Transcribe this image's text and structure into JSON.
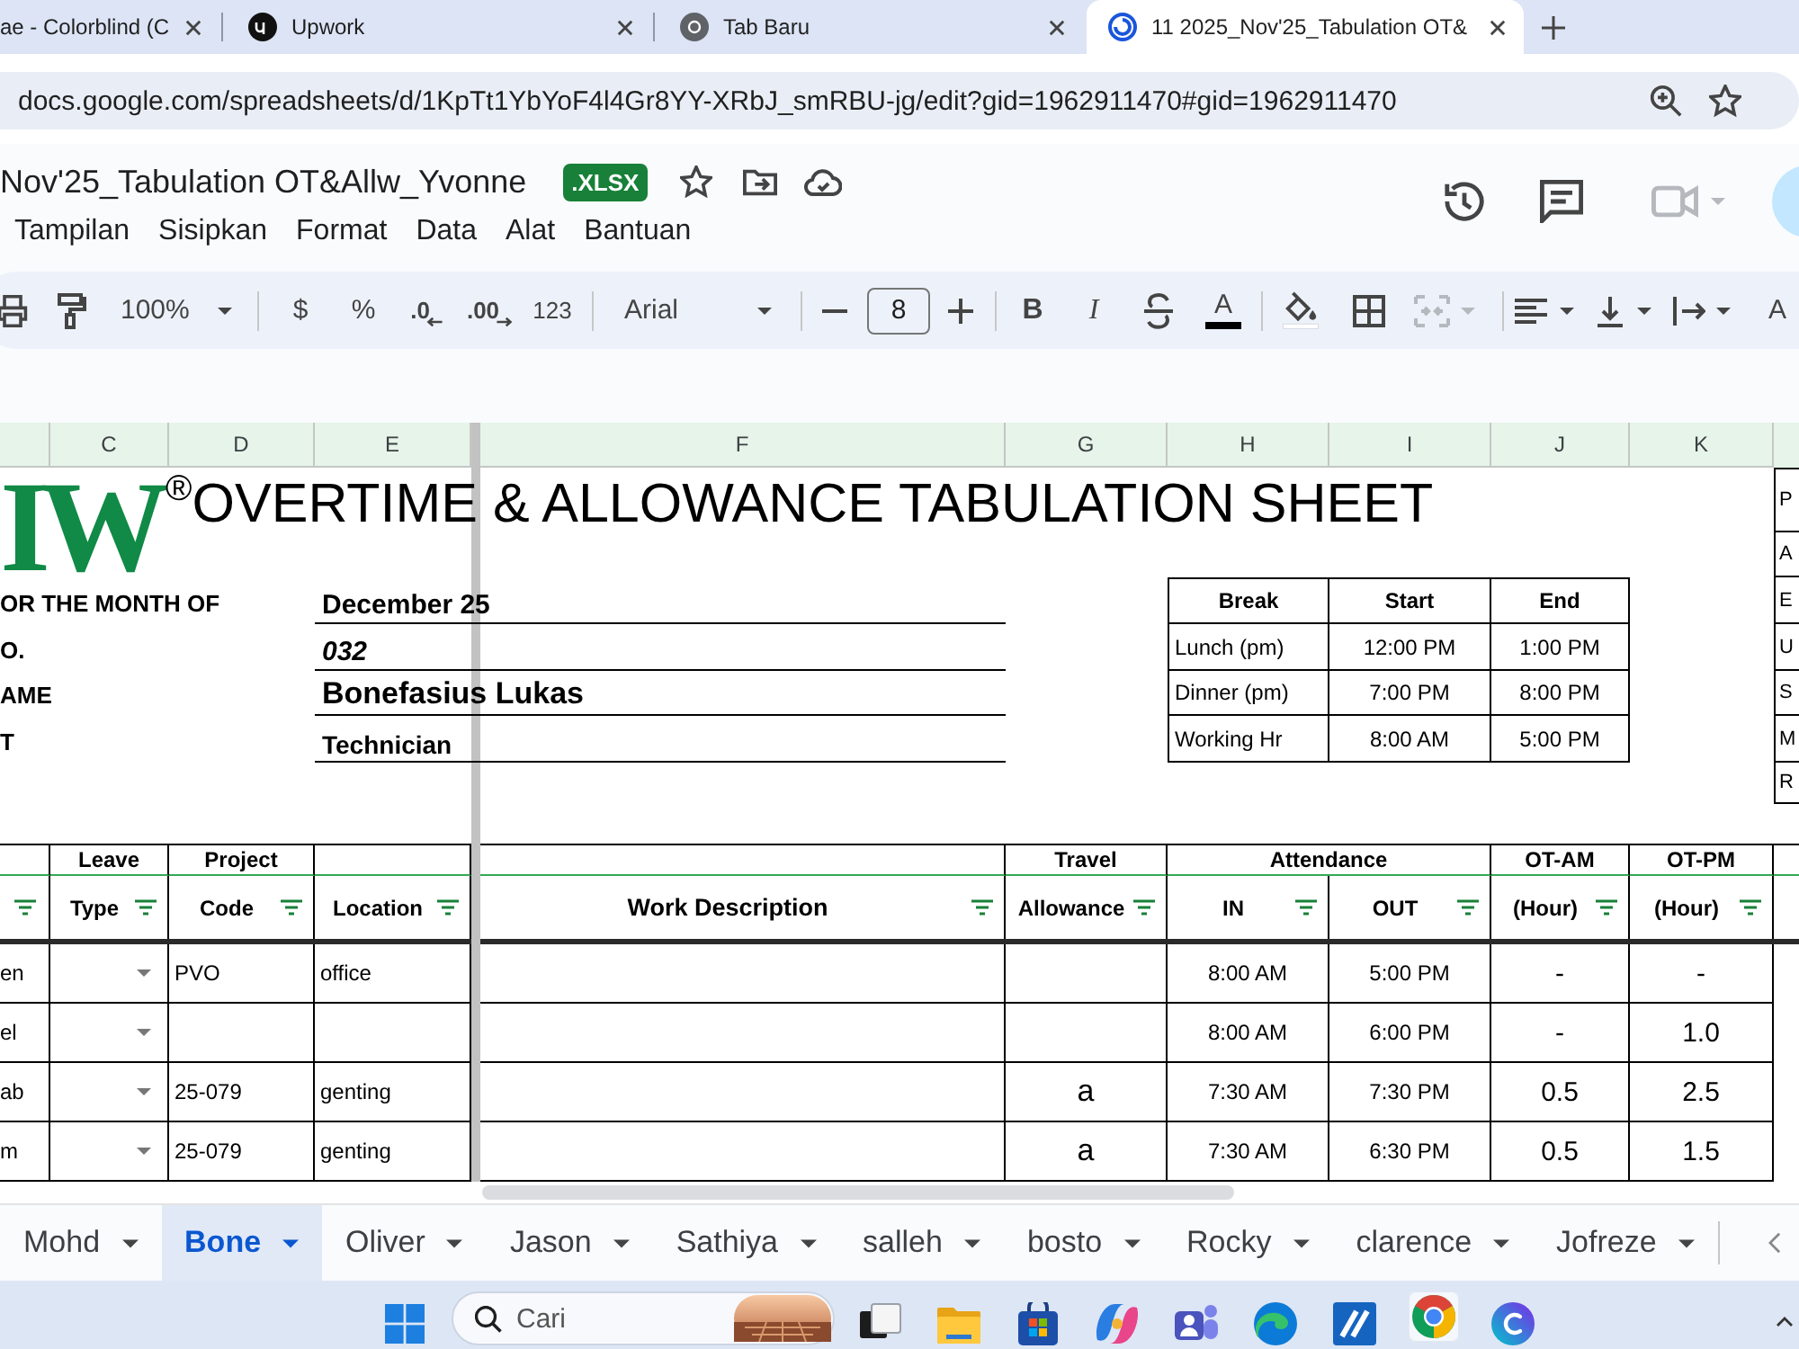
{
  "browser": {
    "tabs": [
      {
        "title": "ae - Colorblind (C",
        "selected": false
      },
      {
        "title": "Upwork",
        "selected": false
      },
      {
        "title": "Tab Baru",
        "selected": false
      },
      {
        "title": "11 2025_Nov'25_Tabulation OT&",
        "selected": true
      }
    ],
    "url": "docs.google.com/spreadsheets/d/1KpTt1YbYoF4l4Gr8YY-XRbJ_smRBU-jg/edit?gid=1962911470#gid=1962911470"
  },
  "document": {
    "title": "Nov'25_Tabulation OT&Allw_Yvonne",
    "file_type": ".XLSX",
    "menu": [
      "Tampilan",
      "Sisipkan",
      "Format",
      "Data",
      "Alat",
      "Bantuan"
    ]
  },
  "toolbar": {
    "zoom": "100%",
    "currency": "$",
    "percent": "%",
    "decrease_decimal": ".0",
    "increase_decimal": ".00",
    "number_format": "123",
    "font": "Arial",
    "font_size": "8",
    "bold": "B",
    "italic": "I",
    "text_color": "A",
    "merge": {
      "disabled": true
    },
    "text_rotation": "A"
  },
  "sheet": {
    "columns": [
      "C",
      "D",
      "E",
      "F",
      "G",
      "H",
      "I",
      "J",
      "K"
    ],
    "logo": "IW$^{®}$",
    "title": "OVERTIME & ALLOWANCE TABULATION SHEET",
    "fields": [
      {
        "label": "OR THE MONTH OF",
        "value": "December 25"
      },
      {
        "label": "O.",
        "value": "032"
      },
      {
        "label": "AME",
        "value": "Bonefasius Lukas"
      },
      {
        "label": "T",
        "value": "Technician"
      }
    ],
    "breaks": {
      "columns": [
        "Break",
        "Start",
        "End"
      ],
      "rows": [
        [
          "Lunch (pm)",
          "12:00 PM",
          "1:00 PM"
        ],
        [
          "Dinner (pm)",
          "7:00 PM",
          "8:00 PM"
        ],
        [
          "Working Hr",
          "8:00 AM",
          "5:00 PM"
        ]
      ]
    },
    "column_l": [
      "P",
      "A",
      "E",
      "U",
      "S",
      "M",
      "R"
    ],
    "table": {
      "groups": [
        {
          "label": "Leave",
          "columns": [
            "Type"
          ]
        },
        {
          "label": "Project",
          "columns": [
            "Code"
          ]
        },
        {
          "columns": [
            "Location"
          ]
        },
        {
          "columns": [
            "Work Description"
          ]
        },
        {
          "label": "Travel",
          "columns": [
            "Allowance"
          ]
        },
        {
          "label": "Attendance",
          "columns": [
            "IN",
            "OUT"
          ]
        },
        {
          "label": "OT-AM",
          "columns": [
            "(Hour)"
          ]
        },
        {
          "label": "OT-PM",
          "columns": [
            "(Hour)"
          ]
        }
      ],
      "rows": [
        {
          "column_1": "en",
          "code": "PVO",
          "location": "office",
          "in": "8:00 AM",
          "out": "5:00 PM",
          "ot_am": "-",
          "ot_pm": "-"
        },
        {
          "column_1": "el",
          "in": "8:00 AM",
          "out": "6:00 PM",
          "ot_am": "-",
          "ot_pm": "1.0"
        },
        {
          "column_1": "ab",
          "code": "25-079",
          "location": "genting",
          "allowance": "a",
          "in": "7:30 AM",
          "out": "7:30 PM",
          "ot_am": "0.5",
          "ot_pm": "2.5"
        },
        {
          "column_1": "m",
          "code": "25-079",
          "location": "genting",
          "allowance": "a",
          "in": "7:30 AM",
          "out": "6:30 PM",
          "ot_am": "0.5",
          "ot_pm": "1.5"
        }
      ]
    }
  },
  "sheet_tabs": [
    {
      "name": "Mohd",
      "selected": false
    },
    {
      "name": "Bone",
      "selected": true
    },
    {
      "name": "Oliver",
      "selected": false
    },
    {
      "name": "Jason",
      "selected": false
    },
    {
      "name": "Sathiya",
      "selected": false
    },
    {
      "name": "salleh",
      "selected": false
    },
    {
      "name": "bosto",
      "selected": false
    },
    {
      "name": "Rocky",
      "selected": false
    },
    {
      "name": "clarence",
      "selected": false
    },
    {
      "name": "Jofreze",
      "selected": false
    }
  ],
  "taskbar": {
    "search": {
      "placeholder": "Cari"
    },
    "apps": [
      {
        "active": false
      },
      {
        "active": false
      },
      {
        "active": false
      },
      {
        "active": false
      },
      {
        "active": false
      },
      {
        "active": false
      },
      {
        "active": false
      },
      {
        "active": true
      },
      {
        "active": false
      }
    ]
  }
}
